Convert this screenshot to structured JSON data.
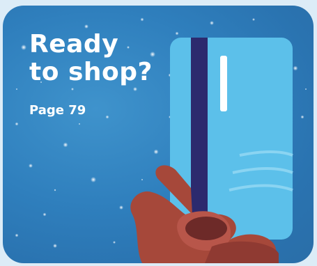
{
  "promo": {
    "headline_line1": "Ready",
    "headline_line2": "to shop?",
    "page_ref": "Page 79"
  },
  "colors": {
    "frame_bg": "#dcecf7",
    "tile_bg": "#2f7fbd",
    "card": "#5cc0ea",
    "stripe": "#2c2a6e",
    "skin": "#a6483a",
    "text": "#ffffff"
  },
  "icons": {
    "card": "credit-card-icon",
    "hand": "hand-icon"
  }
}
